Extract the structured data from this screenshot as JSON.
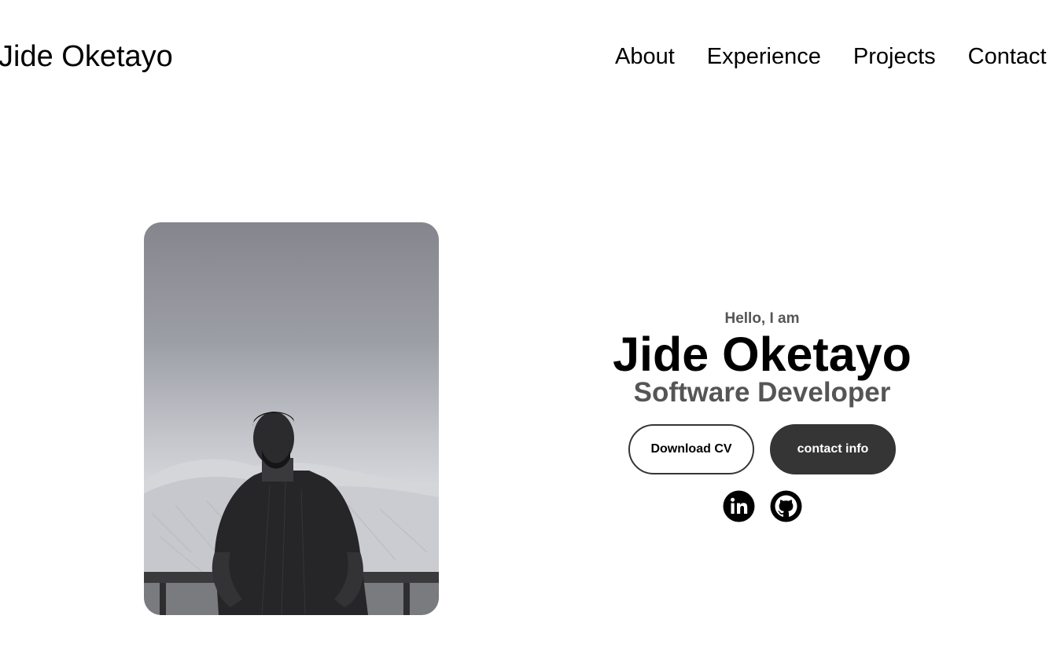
{
  "header": {
    "logo": "Jide Oketayo",
    "nav": [
      "About",
      "Experience",
      "Projects",
      "Contact"
    ]
  },
  "profile": {
    "photo_alt": "Profile picture"
  },
  "hero": {
    "greeting": "Hello, I am",
    "name": "Jide Oketayo",
    "title": "Software Developer",
    "download_cv_label": "Download CV",
    "contact_info_label": "contact info"
  },
  "socials": [
    {
      "icon": "linkedin-icon"
    },
    {
      "icon": "github-icon"
    }
  ],
  "colors": {
    "text": "#000000",
    "muted_text": "#555555",
    "button_dark": "#353535",
    "background": "#ffffff"
  }
}
